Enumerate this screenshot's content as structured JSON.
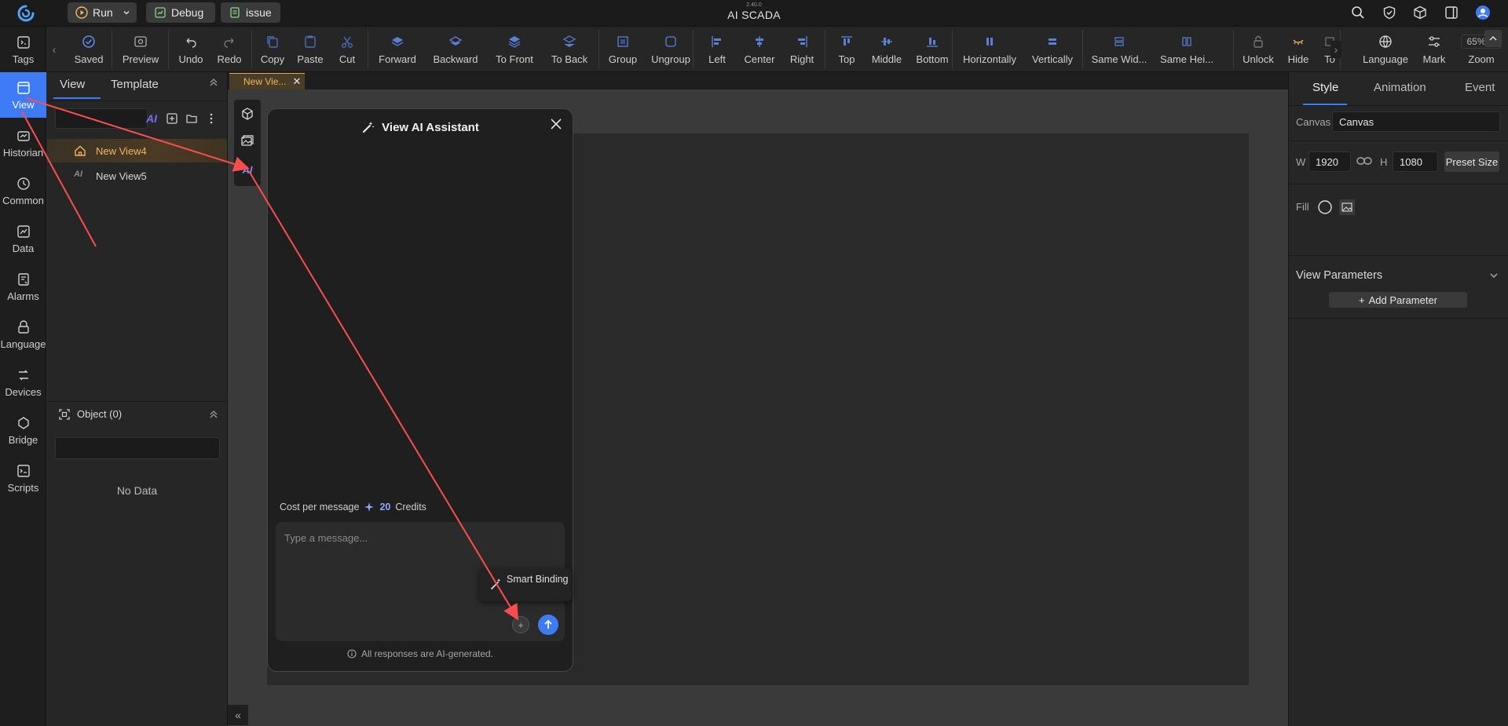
{
  "app": {
    "version": "2.40.0",
    "title": "AI SCADA"
  },
  "titlebar": {
    "run_label": "Run",
    "debug_label": "Debug",
    "issue_label": "issue",
    "icons": [
      "search-icon",
      "shield-check-icon",
      "cube-icon",
      "panel-icon",
      "user-avatar-icon"
    ]
  },
  "rail": {
    "items": [
      {
        "label": "Tags",
        "icon": "tags-icon"
      },
      {
        "label": "View",
        "icon": "view-icon",
        "active": true
      },
      {
        "label": "Historian",
        "icon": "historian-icon"
      },
      {
        "label": "Common",
        "icon": "common-icon"
      },
      {
        "label": "Data",
        "icon": "data-icon"
      },
      {
        "label": "Alarms",
        "icon": "alarms-icon"
      },
      {
        "label": "Language",
        "icon": "language-icon"
      },
      {
        "label": "Devices",
        "icon": "devices-icon"
      },
      {
        "label": "Bridge",
        "icon": "bridge-icon"
      },
      {
        "label": "Scripts",
        "icon": "scripts-icon"
      }
    ]
  },
  "toolbar": {
    "saved": "Saved",
    "preview": "Preview",
    "undo": "Undo",
    "redo": "Redo",
    "copy": "Copy",
    "paste": "Paste",
    "cut": "Cut",
    "forward": "Forward",
    "backward": "Backward",
    "to_front": "To Front",
    "to_back": "To Back",
    "group": "Group",
    "ungroup": "Ungroup",
    "left": "Left",
    "center": "Center",
    "right": "Right",
    "top": "Top",
    "middle": "Middle",
    "bottom": "Bottom",
    "horizontally": "Horizontally",
    "vertically": "Vertically",
    "same_width": "Same Wid...",
    "same_height": "Same Hei...",
    "unlock": "Unlock",
    "hide": "Hide",
    "to_partial": "To",
    "language": "Language",
    "mark": "Mark",
    "zoom": "Zoom",
    "zoom_value": "65%"
  },
  "left_panel": {
    "tabs": [
      "View",
      "Template"
    ],
    "ai_badge": "AI",
    "tree": [
      {
        "label": "New View4",
        "selected": true,
        "icon": "home-icon"
      },
      {
        "label": "New View5",
        "selected": false,
        "icon": "ai-view-icon"
      }
    ],
    "object_header": "Object (0)",
    "no_data": "No Data"
  },
  "editor": {
    "doc_tab": "New Vie...",
    "vtools": [
      "cube-tool-icon",
      "image-tool-icon",
      "ai-tool-icon"
    ]
  },
  "ai_dialog": {
    "title": "View AI Assistant",
    "cost_label": "Cost per message",
    "cost_value": "20",
    "cost_unit": "Credits",
    "placeholder": "Type a message...",
    "smart_binding": "Smart Binding",
    "plus": "+",
    "disclaimer": "All responses are AI-generated."
  },
  "right_panel": {
    "tabs": [
      "Style",
      "Animation",
      "Event"
    ],
    "canvas_label": "Canvas",
    "canvas_value": "Canvas",
    "w_label": "W",
    "w_value": "1920",
    "h_label": "H",
    "h_value": "1080",
    "preset_size": "Preset Size",
    "fill_label": "Fill",
    "view_parameters": "View Parameters",
    "add_parameter": "Add Parameter"
  },
  "colors": {
    "accent": "#3d7bf7",
    "selected_orange": "#f0b560",
    "annotation": "#ff4d4d"
  }
}
